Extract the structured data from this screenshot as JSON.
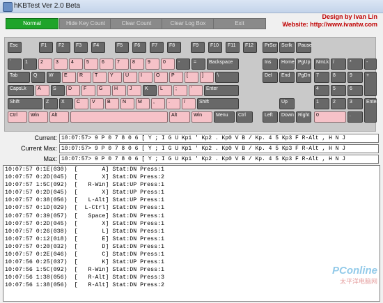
{
  "window": {
    "title": "hKBTest Ver 2.0 Beta"
  },
  "author": {
    "line1": "Design by Ivan Lin",
    "line2": "Website: http://www.ivantw.com"
  },
  "toolbar": [
    {
      "label": "Normal",
      "active": true
    },
    {
      "label": "Hide Key Count",
      "active": false
    },
    {
      "label": "Clear Count",
      "active": false
    },
    {
      "label": "Clear Log Box",
      "active": false
    },
    {
      "label": "Exit",
      "active": false
    }
  ],
  "keyboard": [
    {
      "label": "Esc",
      "pressed": false
    },
    {
      "label": "F1",
      "pressed": false
    },
    {
      "label": "F2",
      "pressed": false
    },
    {
      "label": "F3",
      "pressed": false
    },
    {
      "label": "F4",
      "pressed": false
    },
    {
      "label": "F5",
      "pressed": false
    },
    {
      "label": "F6",
      "pressed": false
    },
    {
      "label": "F7",
      "pressed": false
    },
    {
      "label": "F8",
      "pressed": false
    },
    {
      "label": "F9",
      "pressed": false
    },
    {
      "label": "F10",
      "pressed": false
    },
    {
      "label": "F11",
      "pressed": false
    },
    {
      "label": "F12",
      "pressed": false
    },
    {
      "label": "PrScr",
      "pressed": false
    },
    {
      "label": "Scrlk",
      "pressed": false
    },
    {
      "label": "Pause",
      "pressed": false
    },
    {
      "label": "`",
      "pressed": false
    },
    {
      "label": "1",
      "pressed": false
    },
    {
      "label": "2",
      "pressed": true
    },
    {
      "label": "3",
      "pressed": true
    },
    {
      "label": "4",
      "pressed": true
    },
    {
      "label": "5",
      "pressed": true
    },
    {
      "label": "6",
      "pressed": true
    },
    {
      "label": "7",
      "pressed": true
    },
    {
      "label": "8",
      "pressed": true
    },
    {
      "label": "9",
      "pressed": true
    },
    {
      "label": "0",
      "pressed": true
    },
    {
      "label": "-",
      "pressed": false
    },
    {
      "label": "=",
      "pressed": false
    },
    {
      "label": "Backspace",
      "pressed": false
    },
    {
      "label": "Ins",
      "pressed": false
    },
    {
      "label": "Home",
      "pressed": false
    },
    {
      "label": "PgUp",
      "pressed": false
    },
    {
      "label": "NmLk",
      "pressed": false
    },
    {
      "label": "/",
      "pressed": false
    },
    {
      "label": "*",
      "pressed": false
    },
    {
      "label": "-",
      "pressed": false
    },
    {
      "label": "Tab",
      "pressed": false
    },
    {
      "label": "Q",
      "pressed": false
    },
    {
      "label": "W",
      "pressed": false
    },
    {
      "label": "E",
      "pressed": true
    },
    {
      "label": "R",
      "pressed": true
    },
    {
      "label": "T",
      "pressed": true
    },
    {
      "label": "Y",
      "pressed": true
    },
    {
      "label": "U",
      "pressed": true
    },
    {
      "label": "I",
      "pressed": true
    },
    {
      "label": "O",
      "pressed": true
    },
    {
      "label": "P",
      "pressed": true
    },
    {
      "label": "[",
      "pressed": true
    },
    {
      "label": "]",
      "pressed": true
    },
    {
      "label": "\\",
      "pressed": false
    },
    {
      "label": "Del",
      "pressed": false
    },
    {
      "label": "End",
      "pressed": false
    },
    {
      "label": "PgDn",
      "pressed": false
    },
    {
      "label": "7",
      "pressed": false
    },
    {
      "label": "8",
      "pressed": false
    },
    {
      "label": "9",
      "pressed": false
    },
    {
      "label": "+",
      "pressed": false
    },
    {
      "label": "CapsLk",
      "pressed": false
    },
    {
      "label": "A",
      "pressed": true
    },
    {
      "label": "S",
      "pressed": false
    },
    {
      "label": "D",
      "pressed": true
    },
    {
      "label": "F",
      "pressed": true
    },
    {
      "label": "G",
      "pressed": true
    },
    {
      "label": "H",
      "pressed": true
    },
    {
      "label": "J",
      "pressed": true
    },
    {
      "label": "K",
      "pressed": false
    },
    {
      "label": "L",
      "pressed": true
    },
    {
      "label": ";",
      "pressed": true
    },
    {
      "label": "'",
      "pressed": true
    },
    {
      "label": "Enter",
      "pressed": false
    },
    {
      "label": "4",
      "pressed": false
    },
    {
      "label": "5",
      "pressed": false
    },
    {
      "label": "6",
      "pressed": false
    },
    {
      "label": "Shift",
      "pressed": false
    },
    {
      "label": "Z",
      "pressed": false
    },
    {
      "label": "X",
      "pressed": false
    },
    {
      "label": "C",
      "pressed": true
    },
    {
      "label": "V",
      "pressed": true
    },
    {
      "label": "B",
      "pressed": true
    },
    {
      "label": "N",
      "pressed": true
    },
    {
      "label": "M",
      "pressed": true
    },
    {
      "label": ",",
      "pressed": true
    },
    {
      "label": ".",
      "pressed": true
    },
    {
      "label": "/",
      "pressed": true
    },
    {
      "label": "Shift",
      "pressed": false
    },
    {
      "label": "Up",
      "pressed": false
    },
    {
      "label": "1",
      "pressed": false
    },
    {
      "label": "2",
      "pressed": false
    },
    {
      "label": "3",
      "pressed": false
    },
    {
      "label": "Enter",
      "pressed": false
    },
    {
      "label": "Ctrl",
      "pressed": true
    },
    {
      "label": "Win",
      "pressed": true
    },
    {
      "label": "Alt",
      "pressed": true
    },
    {
      "label": "",
      "pressed": true
    },
    {
      "label": "Alt",
      "pressed": true
    },
    {
      "label": "Win",
      "pressed": true
    },
    {
      "label": "Menu",
      "pressed": false
    },
    {
      "label": "Ctrl",
      "pressed": false
    },
    {
      "label": "Left",
      "pressed": false
    },
    {
      "label": "Down",
      "pressed": false
    },
    {
      "label": "Right",
      "pressed": false
    },
    {
      "label": "0",
      "pressed": true
    },
    {
      "label": ".",
      "pressed": false
    }
  ],
  "status": {
    "current_label": "Current:",
    "current_value": "10:07:57> 9 P 0 7 8 0 6 [ Y ; I G U Kp1 ' Kp2 . Kp0 V B / Kp. 4 5 Kp3 F R-Alt , H N J",
    "currentmax_label": "Current Max:",
    "currentmax_value": "10:07:57> 9 P 0 7 8 0 6 [ Y ; I G U Kp1 ' Kp2 . Kp0 V B / Kp. 4 5 Kp3 F R-Alt , H N J",
    "max_label": "Max:",
    "max_value": "10:07:57> 9 P 0 7 8 0 6 [ Y ; I G U Kp1 ' Kp2 . Kp0 V B / Kp. 4 5 Kp3 F R-Alt , H N J"
  },
  "log": [
    "10:07:57 0:1E(030)  [       A] Stat:DN Press:1",
    "10:07:57 0:2D(045)  [       X] Stat:DN Press:2",
    "10:07:57 1:5C(092)  [   R-Win] Stat:UP Press:1",
    "10:07:57 0:2D(045)  [       X] Stat:UP Press:1",
    "10:07:57 0:38(056)  [   L-Alt] Stat:UP Press:1",
    "10:07:57 0:1D(029)  [  L-Ctrl] Stat:DN Press:1",
    "10:07:57 0:39(057)  [   Space] Stat:DN Press:1",
    "10:07:57 0:2D(045)  [       X] Stat:DN Press:1",
    "10:07:57 0:26(038)  [       L] Stat:DN Press:1",
    "10:07:57 0:12(018)  [       E] Stat:DN Press:1",
    "10:07:57 0:20(032)  [       D] Stat:DN Press:1",
    "10:07:57 0:2E(046)  [       C] Stat:DN Press:1",
    "10:07:56 0:25(037)  [       K] Stat:UP Press:1",
    "10:07:56 1:5C(092)  [   R-Win] Stat:DN Press:1",
    "10:07:56 1:38(056)  [   R-Alt] Stat:DN Press:3",
    "10:07:56 1:38(056)  [   R-Alt] Stat:DN Press:2"
  ],
  "watermark": {
    "main": "PConline",
    "sub": "太平洋电脑网"
  }
}
